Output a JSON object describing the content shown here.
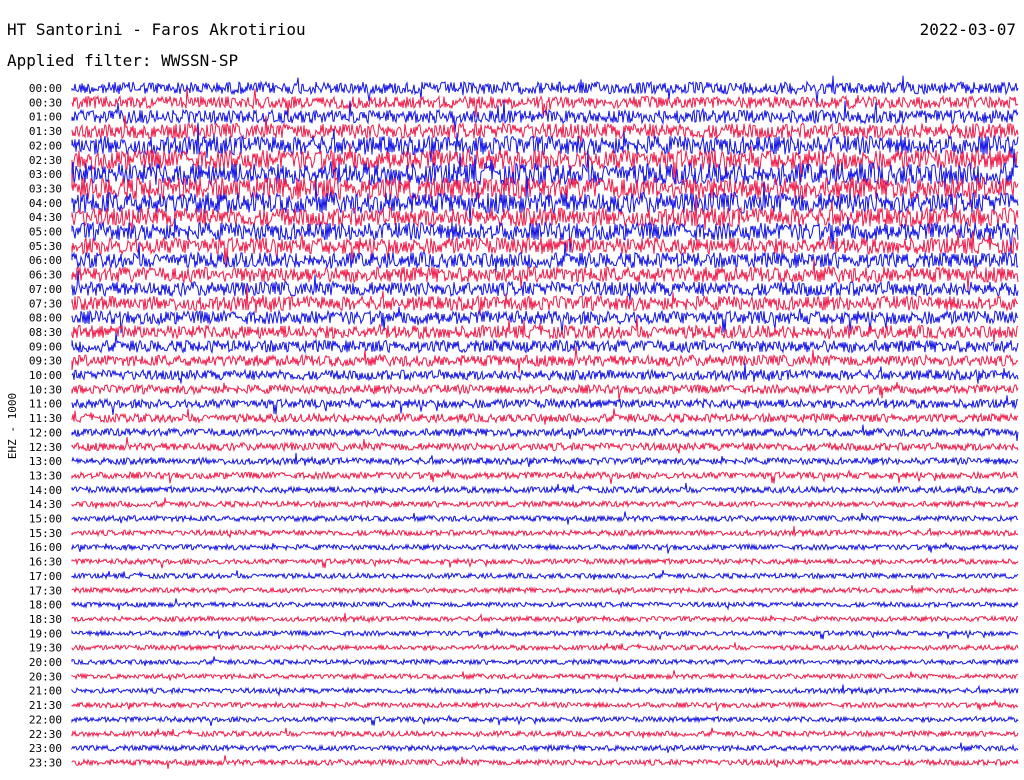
{
  "header": {
    "station": "HT Santorini - Faros Akrotiriou",
    "date": "2022-03-07",
    "filter": "Applied filter: WWSSN-SP"
  },
  "chart_data": {
    "type": "line",
    "title": "HT Santorini - Faros Akrotiriou",
    "subtitle": "Applied filter: WWSSN-SP",
    "ylabel": "EHZ - 1000",
    "row_labels": [
      "00:00",
      "00:30",
      "01:00",
      "01:30",
      "02:00",
      "02:30",
      "03:00",
      "03:30",
      "04:00",
      "04:30",
      "05:00",
      "05:30",
      "06:00",
      "06:30",
      "07:00",
      "07:30",
      "08:00",
      "08:30",
      "09:00",
      "09:30",
      "10:00",
      "10:30",
      "11:00",
      "11:30",
      "12:00",
      "12:30",
      "13:00",
      "13:30",
      "14:00",
      "14:30",
      "15:00",
      "15:30",
      "16:00",
      "16:30",
      "17:00",
      "17:30",
      "18:00",
      "18:30",
      "19:00",
      "19:30",
      "20:00",
      "20:30",
      "21:00",
      "21:30",
      "22:00",
      "22:30",
      "23:00",
      "23:30"
    ],
    "series_colors": [
      "#1414e6",
      "#f01e4b"
    ],
    "relative_noise_amplitude": [
      0.55,
      0.55,
      0.6,
      0.7,
      0.85,
      0.9,
      1.0,
      1.0,
      0.95,
      0.85,
      0.8,
      0.75,
      0.7,
      0.7,
      0.65,
      0.65,
      0.6,
      0.6,
      0.55,
      0.5,
      0.45,
      0.4,
      0.4,
      0.38,
      0.35,
      0.35,
      0.3,
      0.3,
      0.28,
      0.26,
      0.25,
      0.25,
      0.24,
      0.24,
      0.23,
      0.23,
      0.22,
      0.22,
      0.22,
      0.22,
      0.22,
      0.22,
      0.23,
      0.23,
      0.23,
      0.24,
      0.25,
      0.26
    ]
  }
}
